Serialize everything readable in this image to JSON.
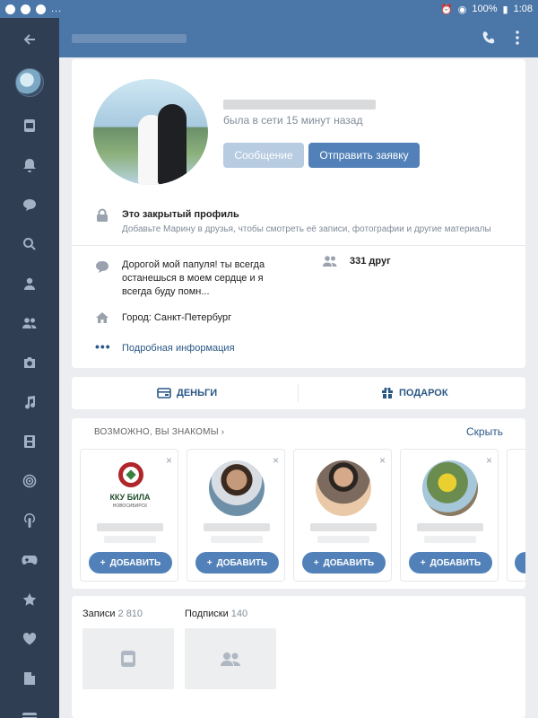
{
  "status_bar": {
    "battery": "100%",
    "time": "1:08",
    "dots": "..."
  },
  "sidebar": {
    "items": [
      {
        "icon": "back-arrow-icon"
      },
      {
        "icon": "user-avatar"
      },
      {
        "icon": "news-icon"
      },
      {
        "icon": "bell-icon"
      },
      {
        "icon": "chat-icon"
      },
      {
        "icon": "search-icon"
      },
      {
        "icon": "person-icon"
      },
      {
        "icon": "friends-icon"
      },
      {
        "icon": "camera-icon"
      },
      {
        "icon": "music-icon"
      },
      {
        "icon": "video-icon"
      },
      {
        "icon": "target-icon"
      },
      {
        "icon": "podcast-icon"
      },
      {
        "icon": "gamepad-icon"
      },
      {
        "icon": "star-icon"
      },
      {
        "icon": "heart-icon"
      },
      {
        "icon": "document-icon"
      },
      {
        "icon": "card-icon"
      }
    ]
  },
  "header": {
    "phone_icon": "phone-icon",
    "menu_icon": "more-vertical-icon"
  },
  "profile": {
    "online_status": "была в сети 15 минут назад",
    "message_button": "Сообщение",
    "add_friend_button": "Отправить заявку",
    "closed_title": "Это закрытый профиль",
    "closed_subtitle": "Добавьте Марину в друзья, чтобы смотреть её записи, фотографии и другие материалы",
    "status_text": "Дорогой мой папуля! ты всегда останешься в моем сердце и я всегда буду помн...",
    "friends_count": "331 друг",
    "city": "Город: Санкт-Петербург",
    "more_info": "Подробная информация"
  },
  "actions": {
    "money": "ДЕНЬГИ",
    "gift": "ПОДАРОК"
  },
  "suggestions": {
    "title": "ВОЗМОЖНО, ВЫ ЗНАКОМЫ",
    "hide": "Скрыть",
    "add_label": "ДОБАВИТЬ",
    "logo_text": "ККУ БИЛА",
    "logo_subtext": "НОВОСИБИРСК",
    "close_glyph": "×",
    "plus_glyph": "+"
  },
  "counters": {
    "posts_label": "Записи",
    "posts_count": "2 810",
    "subs_label": "Подписки",
    "subs_count": "140"
  },
  "colors": {
    "brand": "#4a76a8",
    "sidebar": "#2f3e53",
    "button": "#5181b8",
    "link": "#2a5885"
  }
}
